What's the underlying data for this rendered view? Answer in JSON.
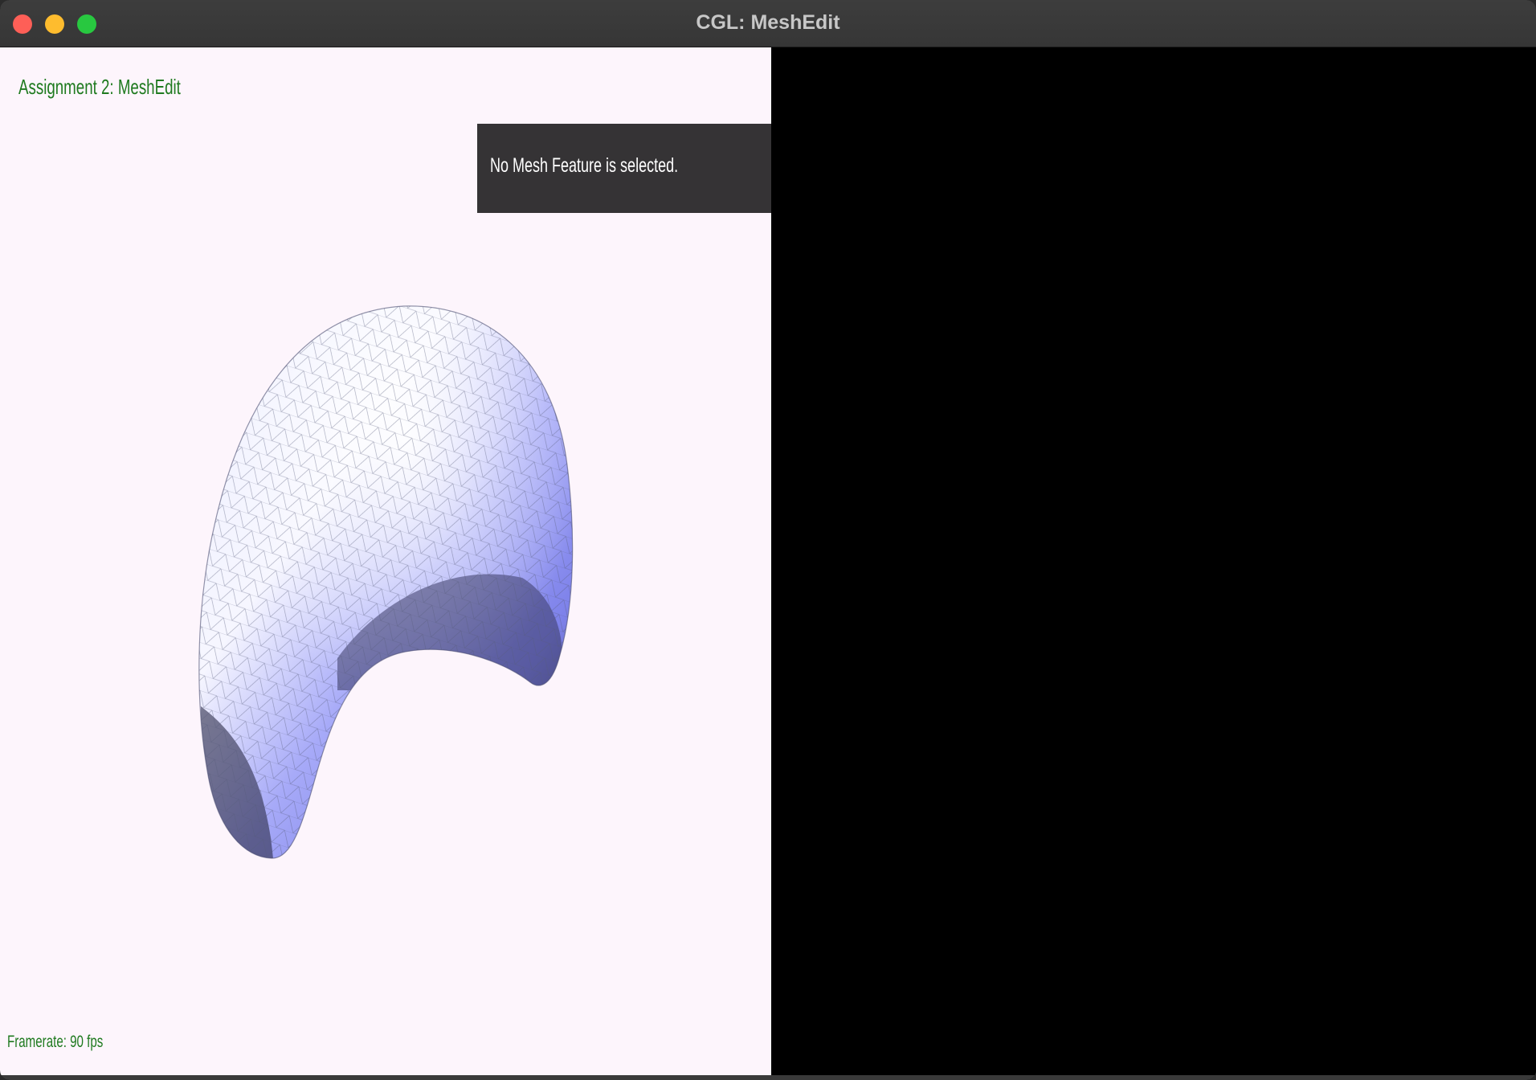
{
  "window": {
    "title": "CGL: MeshEdit"
  },
  "viewport": {
    "heading": "Assignment 2: MeshEdit",
    "info_panel_text": "No Mesh Feature is selected.",
    "framerate": "Framerate: 90 fps",
    "colors": {
      "background": "#fdf5fc",
      "accent_text": "#1f7a1f",
      "mesh_light": "#ffffff",
      "mesh_mid": "#8c8ff2",
      "mesh_dark": "#2a2a44"
    }
  },
  "icons": {
    "close": "close-icon",
    "minimize": "minimize-icon",
    "maximize": "maximize-icon"
  }
}
